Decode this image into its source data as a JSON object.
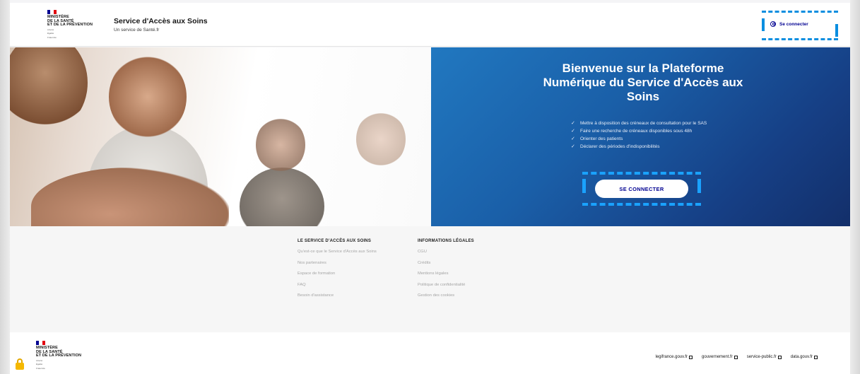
{
  "header": {
    "ministry_lines": [
      "MINISTÈRE",
      "DE LA SANTÉ",
      "ET DE LA PRÉVENTION"
    ],
    "motto_lines": [
      "Liberté",
      "Égalité",
      "Fraternité"
    ],
    "service_title": "Service d'Accès aux Soins",
    "service_subtitle": "Un service de Santé.fr",
    "login_label": "Se connecter"
  },
  "hero": {
    "title": "Bienvenue sur la Plateforme Numérique du Service d'Accès aux Soins",
    "bullets": [
      "Mettre à disposition des créneaux de consultation pour le SAS",
      "Faire une recherche de créneaux disponibles sous 48h",
      "Orienter des patients",
      "Déclarer des périodes d'indisponibilités"
    ],
    "cta_label": "SE CONNECTER"
  },
  "footer": {
    "col1": {
      "heading": "LE SERVICE D'ACCÈS AUX SOINS",
      "links": [
        "Qu'est-ce que le Service d'Accès aux Soins",
        "Nos partenaires",
        "Espace de formation",
        "FAQ",
        "Besoin d'assistance"
      ]
    },
    "col2": {
      "heading": "INFORMATIONS LÉGALES",
      "links": [
        "CGU",
        "Crédits",
        "Mentions légales",
        "Politique de confidentialité",
        "Gestion des cookies"
      ]
    },
    "external_links": [
      "legifrance.gouv.fr",
      "gouvernement.fr",
      "service-public.fr",
      "data.gouv.fr"
    ]
  },
  "colors": {
    "brand_blue": "#000091",
    "hero_panel": "#1a5fa8",
    "highlight": "#0a8ee0",
    "flag_red": "#e1000f"
  }
}
